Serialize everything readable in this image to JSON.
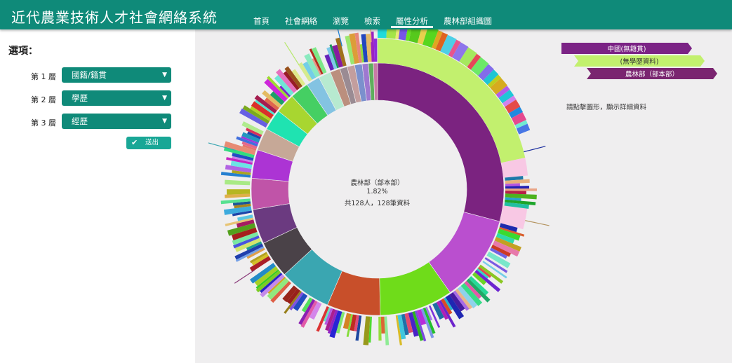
{
  "header": {
    "brand": "近代農業技術人才社會網絡系統",
    "nav": [
      "首頁",
      "社會網絡",
      "瀏覽",
      "檢索",
      "屬性分析",
      "農林部組織圖"
    ],
    "active_index": 4,
    "bg_color": "#0f8a79"
  },
  "sidebar": {
    "title": "選項：",
    "rows": [
      {
        "label": "第 1 層",
        "value": "國籍/籍貫"
      },
      {
        "label": "第 2 層",
        "value": "學歷"
      },
      {
        "label": "第 3 層",
        "value": "經歷"
      }
    ],
    "submit_label": "送出",
    "submit_icon": "check-icon",
    "select_icon": "chevron-down-icon"
  },
  "center": {
    "name": "農林部（部本部）",
    "percent": "1.82%",
    "count": "共128人，128筆資料"
  },
  "breadcrumbs": [
    {
      "label": "中國(無籍貫)",
      "color": "#7b2385"
    },
    {
      "label": "(無學歷資料)",
      "color": "#c2f06e"
    },
    {
      "label": "農林部（部本部）",
      "color": "#7a2570"
    }
  ],
  "hint": "請點擊圖形，顯示詳細資料",
  "chart_data": {
    "type": "sunburst",
    "center_label": "農林部（部本部）",
    "center_percent": "1.82%",
    "center_count": "共128人，128筆資料",
    "ring1_colors": [
      "#7b2380",
      "#ba4fcf",
      "#6fdc1a",
      "#c84f2a",
      "#3aa6b1",
      "#4a4248",
      "#6b3a80",
      "#c054a8",
      "#ac34d4",
      "#c6a897",
      "#1fe3b1",
      "#a8d630",
      "#45cf63",
      "#83c3e2",
      "#b7ead0",
      "#bb8f7e",
      "#9a8b93",
      "#c39e9e",
      "#7b90cd",
      "#9e78d0",
      "#5fae5d",
      "#c97aa6"
    ],
    "highlight_color": "#c2f06e"
  }
}
